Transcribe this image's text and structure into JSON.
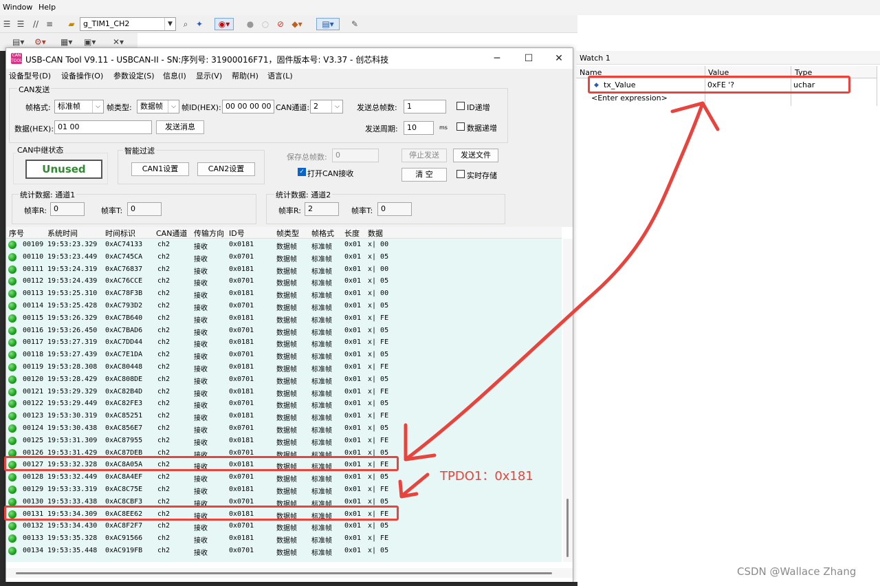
{
  "ide": {
    "menu": [
      "Window",
      "Help"
    ],
    "target_combo": "g_TIM1_CH2"
  },
  "watch": {
    "title": "Watch 1",
    "columns": [
      "Name",
      "Value",
      "Type"
    ],
    "var_name": "tx_Value",
    "var_value": "0xFE '?",
    "var_type": "uchar",
    "enter_expr": "<Enter expression>"
  },
  "can_tool": {
    "title": "USB-CAN Tool V9.11 - USBCAN-II - SN:序列号: 31900016F71，固件版本号: V3.37 - 创芯科技",
    "menu": [
      "设备型号(D)",
      "设备操作(O)",
      "参数设定(S)",
      "信息(I)",
      "显示(V)",
      "帮助(H)",
      "语言(L)"
    ],
    "send": {
      "group_title": "CAN发送",
      "frame_format_label": "帧格式:",
      "frame_format": "标准帧",
      "frame_type_label": "帧类型:",
      "frame_type": "数据帧",
      "frame_id_label": "帧ID(HEX):",
      "frame_id": "00 00 00 00",
      "channel_label": "CAN通道:",
      "channel": "2",
      "total_frames_label": "发送总帧数:",
      "total_frames": "1",
      "id_inc_label": "ID递增",
      "data_label": "数据(HEX):",
      "data": "01 00",
      "send_button": "发送消息",
      "period_label": "发送周期:",
      "period": "10",
      "period_unit": "ms",
      "data_inc_label": "数据递增"
    },
    "relay": {
      "title": "CAN中继状态",
      "status": "Unused"
    },
    "filter": {
      "title": "智能过滤",
      "can1": "CAN1设置",
      "can2": "CAN2设置"
    },
    "misc": {
      "save_total_label": "保存总帧数:",
      "save_total": "0",
      "stop_send": "停止发送",
      "send_file": "发送文件",
      "open_recv": "打开CAN接收",
      "clear": "清  空",
      "realtime_save": "实时存储"
    },
    "stats1": {
      "title": "统计数据: 通道1",
      "rx_label": "帧率R:",
      "rx": "0",
      "tx_label": "帧率T:",
      "tx": "0"
    },
    "stats2": {
      "title": "统计数据: 通道2",
      "rx_label": "帧率R:",
      "rx": "2",
      "tx_label": "帧率T:",
      "tx": "0"
    },
    "table": {
      "columns": [
        "序号",
        "系统时间",
        "时间标识",
        "CAN通道",
        "传输方向",
        "ID号",
        "帧类型",
        "帧格式",
        "长度",
        "数据"
      ],
      "rows": [
        [
          "00109",
          "19:53:23.329",
          "0xAC74133",
          "ch2",
          "接收",
          "0x0181",
          "数据帧",
          "标准帧",
          "0x01",
          "x| 00"
        ],
        [
          "00110",
          "19:53:23.449",
          "0xAC745CA",
          "ch2",
          "接收",
          "0x0701",
          "数据帧",
          "标准帧",
          "0x01",
          "x| 05"
        ],
        [
          "00111",
          "19:53:24.319",
          "0xAC76837",
          "ch2",
          "接收",
          "0x0181",
          "数据帧",
          "标准帧",
          "0x01",
          "x| 00"
        ],
        [
          "00112",
          "19:53:24.439",
          "0xAC76CCE",
          "ch2",
          "接收",
          "0x0701",
          "数据帧",
          "标准帧",
          "0x01",
          "x| 05"
        ],
        [
          "00113",
          "19:53:25.310",
          "0xAC78F3B",
          "ch2",
          "接收",
          "0x0181",
          "数据帧",
          "标准帧",
          "0x01",
          "x| 00"
        ],
        [
          "00114",
          "19:53:25.428",
          "0xAC793D2",
          "ch2",
          "接收",
          "0x0701",
          "数据帧",
          "标准帧",
          "0x01",
          "x| 05"
        ],
        [
          "00115",
          "19:53:26.329",
          "0xAC7B640",
          "ch2",
          "接收",
          "0x0181",
          "数据帧",
          "标准帧",
          "0x01",
          "x| FE"
        ],
        [
          "00116",
          "19:53:26.450",
          "0xAC7BAD6",
          "ch2",
          "接收",
          "0x0701",
          "数据帧",
          "标准帧",
          "0x01",
          "x| 05"
        ],
        [
          "00117",
          "19:53:27.319",
          "0xAC7DD44",
          "ch2",
          "接收",
          "0x0181",
          "数据帧",
          "标准帧",
          "0x01",
          "x| FE"
        ],
        [
          "00118",
          "19:53:27.439",
          "0xAC7E1DA",
          "ch2",
          "接收",
          "0x0701",
          "数据帧",
          "标准帧",
          "0x01",
          "x| 05"
        ],
        [
          "00119",
          "19:53:28.308",
          "0xAC80448",
          "ch2",
          "接收",
          "0x0181",
          "数据帧",
          "标准帧",
          "0x01",
          "x| FE"
        ],
        [
          "00120",
          "19:53:28.429",
          "0xAC808DE",
          "ch2",
          "接收",
          "0x0701",
          "数据帧",
          "标准帧",
          "0x01",
          "x| 05"
        ],
        [
          "00121",
          "19:53:29.329",
          "0xAC82B4D",
          "ch2",
          "接收",
          "0x0181",
          "数据帧",
          "标准帧",
          "0x01",
          "x| FE"
        ],
        [
          "00122",
          "19:53:29.449",
          "0xAC82FE3",
          "ch2",
          "接收",
          "0x0701",
          "数据帧",
          "标准帧",
          "0x01",
          "x| 05"
        ],
        [
          "00123",
          "19:53:30.319",
          "0xAC85251",
          "ch2",
          "接收",
          "0x0181",
          "数据帧",
          "标准帧",
          "0x01",
          "x| FE"
        ],
        [
          "00124",
          "19:53:30.438",
          "0xAC856E7",
          "ch2",
          "接收",
          "0x0701",
          "数据帧",
          "标准帧",
          "0x01",
          "x| 05"
        ],
        [
          "00125",
          "19:53:31.309",
          "0xAC87955",
          "ch2",
          "接收",
          "0x0181",
          "数据帧",
          "标准帧",
          "0x01",
          "x| FE"
        ],
        [
          "00126",
          "19:53:31.429",
          "0xAC87DEB",
          "ch2",
          "接收",
          "0x0701",
          "数据帧",
          "标准帧",
          "0x01",
          "x| 05"
        ],
        [
          "00127",
          "19:53:32.328",
          "0xAC8A05A",
          "ch2",
          "接收",
          "0x0181",
          "数据帧",
          "标准帧",
          "0x01",
          "x| FE"
        ],
        [
          "00128",
          "19:53:32.449",
          "0xAC8A4EF",
          "ch2",
          "接收",
          "0x0701",
          "数据帧",
          "标准帧",
          "0x01",
          "x| 05"
        ],
        [
          "00129",
          "19:53:33.319",
          "0xAC8C75E",
          "ch2",
          "接收",
          "0x0181",
          "数据帧",
          "标准帧",
          "0x01",
          "x| FE"
        ],
        [
          "00130",
          "19:53:33.438",
          "0xAC8CBF3",
          "ch2",
          "接收",
          "0x0701",
          "数据帧",
          "标准帧",
          "0x01",
          "x| 05"
        ],
        [
          "00131",
          "19:53:34.309",
          "0xAC8EE62",
          "ch2",
          "接收",
          "0x0181",
          "数据帧",
          "标准帧",
          "0x01",
          "x| FE"
        ],
        [
          "00132",
          "19:53:34.430",
          "0xAC8F2F7",
          "ch2",
          "接收",
          "0x0701",
          "数据帧",
          "标准帧",
          "0x01",
          "x| 05"
        ],
        [
          "00133",
          "19:53:35.328",
          "0xAC91566",
          "ch2",
          "接收",
          "0x0181",
          "数据帧",
          "标准帧",
          "0x01",
          "x| FE"
        ],
        [
          "00134",
          "19:53:35.448",
          "0xAC919FB",
          "ch2",
          "接收",
          "0x0701",
          "数据帧",
          "标准帧",
          "0x01",
          "x| 05"
        ]
      ],
      "highlighted_rows": [
        "00127",
        "00131"
      ]
    }
  },
  "annotation": {
    "label": "TPDO1：0x181",
    "color": "#e8433c"
  },
  "watermark": "CSDN @Wallace Zhang",
  "colors": {
    "row_bg": "#e6f7f6",
    "status_ok": "#18a018",
    "unused_text": "#2e8b2e"
  }
}
